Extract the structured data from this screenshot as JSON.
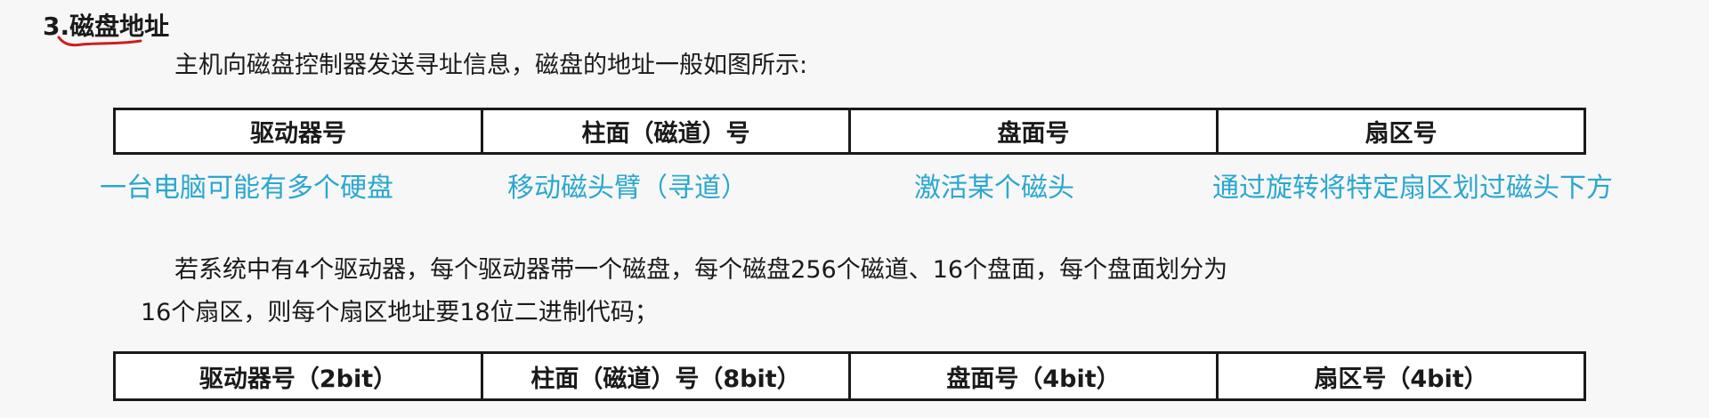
{
  "heading": "3.磁盘地址",
  "intro": "主机向磁盘控制器发送寻址信息，磁盘的地址一般如图所示:",
  "table1": {
    "cells": [
      "驱动器号",
      "柱面（磁道）号",
      "盘面号",
      "扇区号"
    ]
  },
  "notes": [
    "一台电脑可能有多个硬盘",
    "移动磁头臂（寻道）",
    "激活某个磁头",
    "通过旋转将特定扇区划过磁头下方"
  ],
  "paragraph": {
    "line1": "若系统中有4个驱动器，每个驱动器带一个磁盘，每个磁盘256个磁道、16个盘面，每个盘面划分为",
    "line2": "16个扇区，则每个扇区地址要18位二进制代码；"
  },
  "table2": {
    "cells": [
      "驱动器号（2bit）",
      "柱面（磁道）号（8bit）",
      "盘面号（4bit）",
      "扇区号（4bit）"
    ]
  },
  "colors": {
    "note_text": "#2aa7cf",
    "annotation_pen": "#cc1f1f"
  }
}
